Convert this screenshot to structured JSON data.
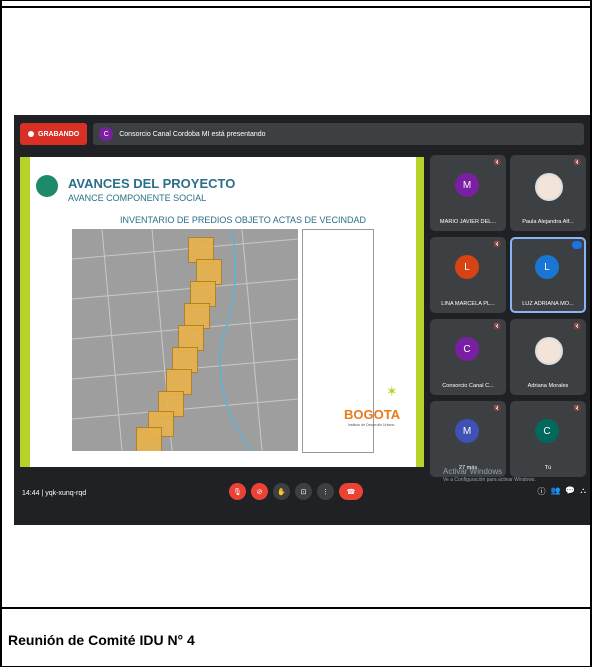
{
  "caption": "Reunión de Comité IDU N° 4",
  "meet": {
    "recording_label": "GRABANDO",
    "presenter_initial": "C",
    "presenting_text": "Consorcio Canal Cordoba MI está presentando",
    "meeting_code": "yqk-xunq-rqd",
    "time": "14:44",
    "separator": "|",
    "activate_windows": "Activar Windows",
    "activate_sub": "Ve a Configuración para activar Windows."
  },
  "slide": {
    "title": "AVANCES DEL PROYECTO",
    "subtitle": "AVANCE COMPONENTE SOCIAL",
    "map_title": "INVENTARIO DE PREDIOS OBJETO ACTAS DE VECINDAD",
    "logo": "BOGOTA",
    "logo_sub": "Instituto de Desarrollo Urbano"
  },
  "participants": [
    {
      "initial": "M",
      "name": "MARIO JAVIER DEL...",
      "color": "#7b1fa2"
    },
    {
      "initial": "",
      "name": "Paula Alejandra Alf...",
      "color": "#ffffff"
    },
    {
      "initial": "L",
      "name": "LINA MARCELA PL...",
      "color": "#d84315"
    },
    {
      "initial": "L",
      "name": "LUZ ADRIANA MO...",
      "color": "#1976d2"
    },
    {
      "initial": "C",
      "name": "Consorcio Canal C...",
      "color": "#7b1fa2"
    },
    {
      "initial": "",
      "name": "Adriana Morales",
      "color": "#ffffff"
    },
    {
      "initial": "M",
      "name": "27 más",
      "color": "#3f51b5"
    },
    {
      "initial": "C",
      "name": "Tú",
      "color": "#00695c"
    }
  ],
  "controls": [
    "mic-off",
    "camera-off",
    "raise-hand",
    "present",
    "more",
    "end-call"
  ]
}
